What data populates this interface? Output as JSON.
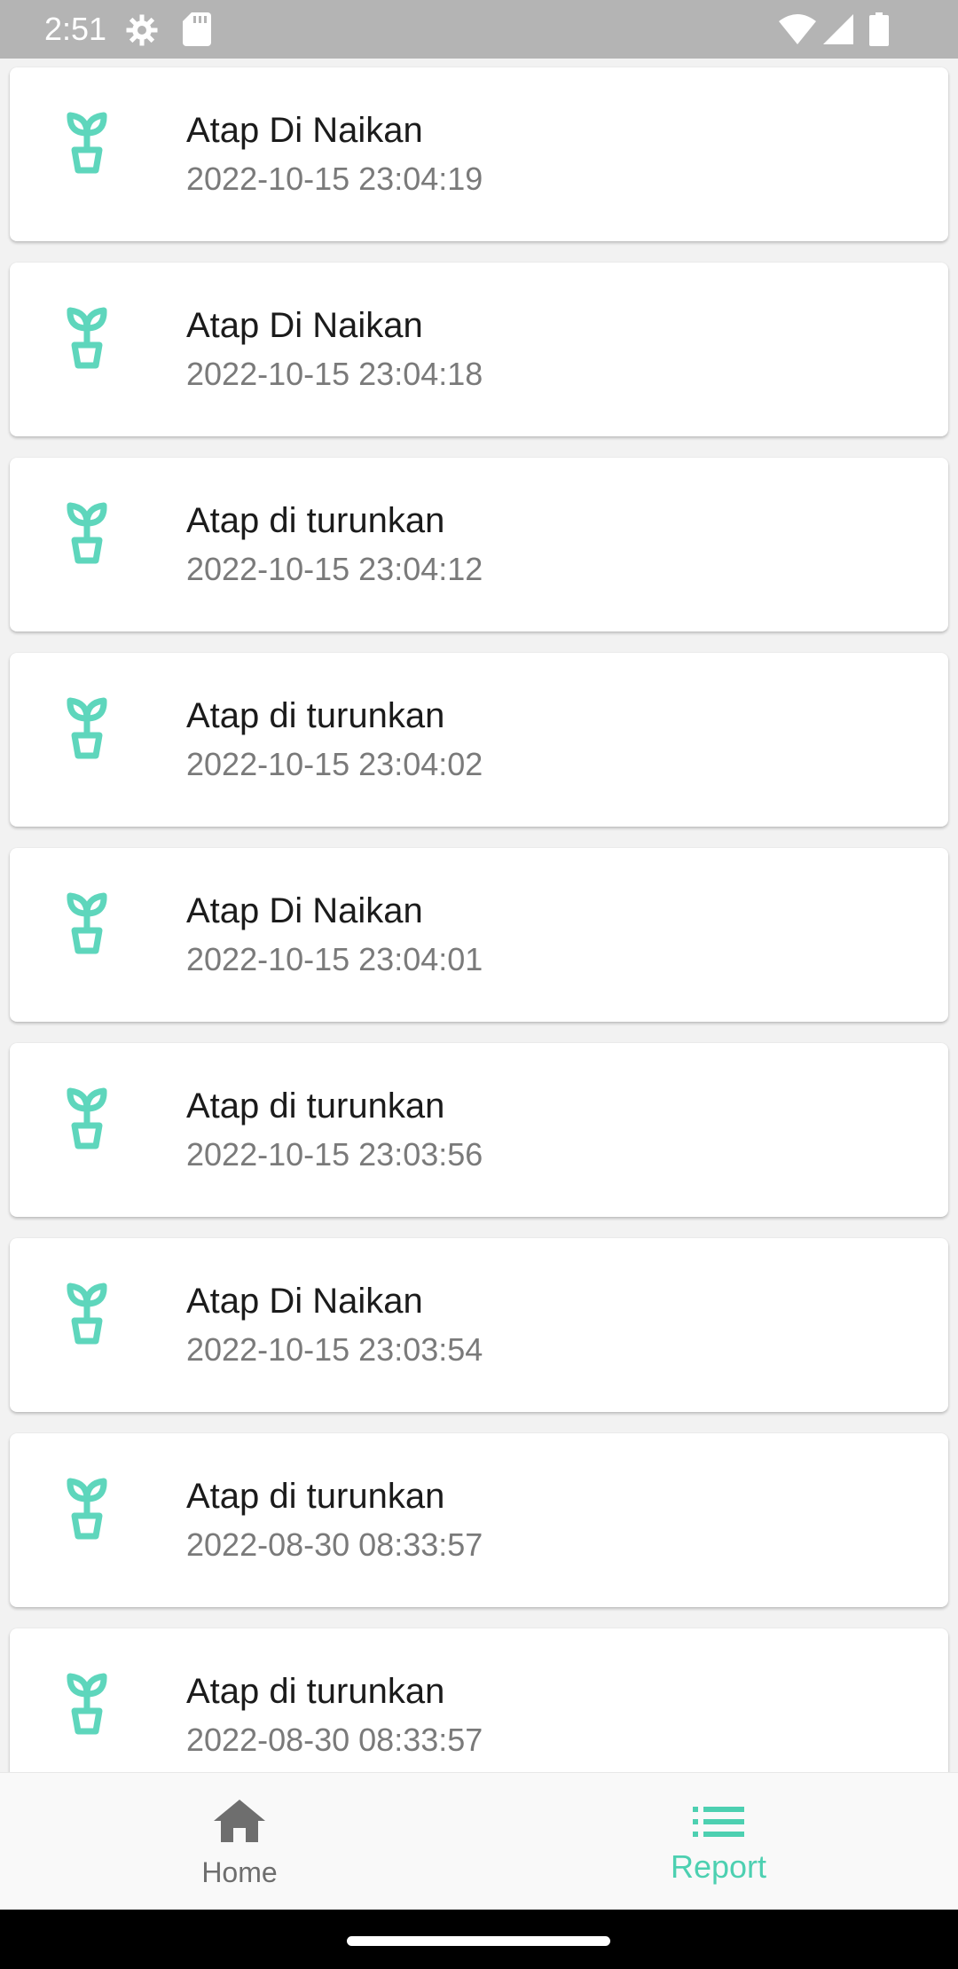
{
  "status_bar": {
    "time": "2:51",
    "left_icons": [
      "gear-icon",
      "sd-card-icon"
    ],
    "right_icons": [
      "wifi-icon",
      "signal-icon",
      "battery-icon"
    ]
  },
  "colors": {
    "accent": "#4dd0b1",
    "icon_teal": "#5ed6bc",
    "nav_inactive": "#6e6e6e"
  },
  "report": {
    "items": [
      {
        "title": "Atap Di Naikan",
        "time": "2022-10-15 23:04:19",
        "icon": "plant-pot-icon"
      },
      {
        "title": "Atap Di Naikan",
        "time": "2022-10-15 23:04:18",
        "icon": "plant-pot-icon"
      },
      {
        "title": "Atap di turunkan",
        "time": "2022-10-15 23:04:12",
        "icon": "plant-pot-icon"
      },
      {
        "title": "Atap di turunkan",
        "time": "2022-10-15 23:04:02",
        "icon": "plant-pot-icon"
      },
      {
        "title": "Atap Di Naikan",
        "time": "2022-10-15 23:04:01",
        "icon": "plant-pot-icon"
      },
      {
        "title": "Atap di turunkan",
        "time": "2022-10-15 23:03:56",
        "icon": "plant-pot-icon"
      },
      {
        "title": "Atap Di Naikan",
        "time": "2022-10-15 23:03:54",
        "icon": "plant-pot-icon"
      },
      {
        "title": "Atap di turunkan",
        "time": "2022-08-30 08:33:57",
        "icon": "plant-pot-icon"
      },
      {
        "title": "Atap di turunkan",
        "time": "2022-08-30 08:33:57",
        "icon": "plant-pot-icon"
      }
    ]
  },
  "bottom_nav": {
    "home_label": "Home",
    "report_label": "Report",
    "active": "Report"
  }
}
